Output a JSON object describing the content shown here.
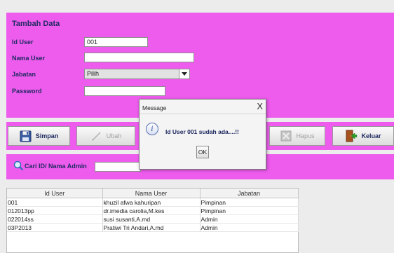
{
  "form": {
    "title": "Tambah Data",
    "labels": {
      "id_user": "Id User",
      "nama_user": "Nama User",
      "jabatan": "Jabatan",
      "password": "Password"
    },
    "values": {
      "id_user": "001",
      "nama_user": "",
      "jabatan": "Pilih",
      "password": ""
    }
  },
  "buttons": {
    "simpan": "Simpan",
    "ubah": "Ubah",
    "hapus": "Hapus",
    "keluar": "Keluar"
  },
  "search": {
    "label": "Cari ID/ Nama Admin",
    "value": ""
  },
  "table": {
    "columns": [
      "Id User",
      "Nama User",
      "Jabatan"
    ],
    "rows": [
      [
        "001",
        "khuzil afwa kahuripan",
        "Pimpinan"
      ],
      [
        "012013pp",
        "dr.imedia carolia,M.kes",
        "Pimpinan"
      ],
      [
        "022014ss",
        "susi susanti,A.md",
        "Admin"
      ],
      [
        "03P2013",
        "Pratiwi Tri Andari,A.md",
        "Admin"
      ]
    ]
  },
  "dialog": {
    "title": "Message",
    "close": "X",
    "message": "Id User 001 sudah ada....!!",
    "ok": "OK"
  },
  "colors": {
    "panel": "#ee5cee",
    "label_text": "#1f2a60"
  },
  "icons": [
    "floppy-disk-icon",
    "pencil-icon",
    "delete-icon",
    "exit-door-icon",
    "search-icon",
    "info-icon",
    "combo-arrow-icon"
  ]
}
